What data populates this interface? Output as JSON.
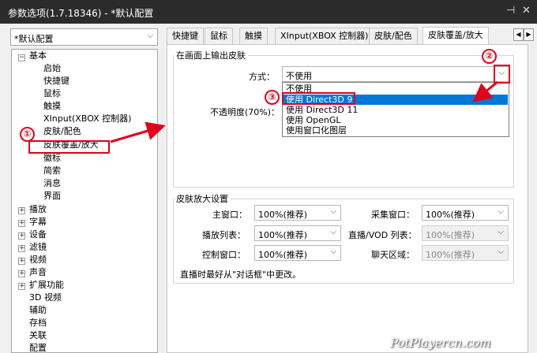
{
  "window": {
    "title": "参数选项(1.7.18346) - *默认配置",
    "pin_icon": "⊣",
    "close_icon": "✕"
  },
  "preset": {
    "value": "*默认配置"
  },
  "tree": {
    "root": "基本",
    "children": [
      "启始",
      "快捷键",
      "鼠标",
      "触摸",
      "XInput(XBOX 控制器)",
      "皮肤/配色",
      "皮肤覆盖/放大",
      "徽标",
      "简索",
      "消息",
      "界面"
    ],
    "groups": [
      "播放",
      "字幕",
      "设备",
      "滤镜",
      "视频",
      "声音",
      "扩展功能"
    ],
    "leaves": [
      "3D 视频",
      "辅助",
      "存档",
      "关联",
      "配置"
    ]
  },
  "tabs": [
    "快捷键",
    "鼠标",
    "触摸",
    "XInput(XBOX 控制器)",
    "皮肤/配色",
    "皮肤覆盖/放大"
  ],
  "tab_scroll": {
    "left": "◀",
    "right": "▶"
  },
  "output_group": {
    "legend": "在画面上输出皮肤",
    "method_label": "方式：",
    "method_value": "不使用",
    "opacity_label": "不透明度(70%)：",
    "options": [
      "不使用",
      "使用 Direct3D 9",
      "使用 Direct3D 11",
      "使用 OpenGL",
      "使用窗口化图层"
    ],
    "selected_option_index": 1
  },
  "zoom_group": {
    "legend": "皮肤放大设置",
    "main_window_label": "主窗口：",
    "main_window_value": "100%(推荐)",
    "capture_window_label": "采集窗口：",
    "capture_window_value": "100%(推荐)",
    "playlist_label": "播放列表：",
    "playlist_value": "100%(推荐)",
    "live_vod_label": "直播/VOD 列表：",
    "live_vod_value": "100%(推荐)",
    "control_window_label": "控制窗口：",
    "control_window_value": "100%(推荐)",
    "chat_label": "聊天区域：",
    "chat_value": "100%(推荐)",
    "note": "直播时最好从\"对话框\"中更改。"
  },
  "annotations": {
    "step1": "①",
    "step2": "②",
    "step3": "③",
    "accent_color": "#e2001a"
  },
  "watermark": "PotPlayercn.com"
}
